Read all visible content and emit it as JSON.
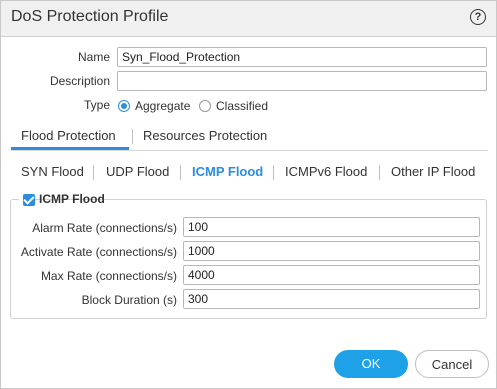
{
  "dialog": {
    "title": "DoS Protection Profile",
    "help_icon": "help-icon"
  },
  "form": {
    "name_label": "Name",
    "name_value": "Syn_Flood_Protection",
    "description_label": "Description",
    "description_value": "",
    "type_label": "Type",
    "type_options": [
      {
        "label": "Aggregate",
        "selected": true
      },
      {
        "label": "Classified",
        "selected": false
      }
    ]
  },
  "tabs": [
    {
      "label": "Flood Protection",
      "active": true
    },
    {
      "label": "Resources Protection",
      "active": false
    }
  ],
  "subtabs": [
    {
      "label": "SYN Flood",
      "active": false
    },
    {
      "label": "UDP Flood",
      "active": false
    },
    {
      "label": "ICMP Flood",
      "active": true
    },
    {
      "label": "ICMPv6 Flood",
      "active": false
    },
    {
      "label": "Other IP Flood",
      "active": false
    }
  ],
  "icmp_flood": {
    "legend": "ICMP Flood",
    "enabled": true,
    "fields": [
      {
        "label": "Alarm Rate (connections/s)",
        "value": "100"
      },
      {
        "label": "Activate Rate (connections/s)",
        "value": "1000"
      },
      {
        "label": "Max Rate (connections/s)",
        "value": "4000"
      },
      {
        "label": "Block Duration (s)",
        "value": "300"
      }
    ]
  },
  "buttons": {
    "ok": "OK",
    "cancel": "Cancel"
  },
  "colors": {
    "accent": "#2a8ddf",
    "ok_button": "#1ea1e6"
  }
}
